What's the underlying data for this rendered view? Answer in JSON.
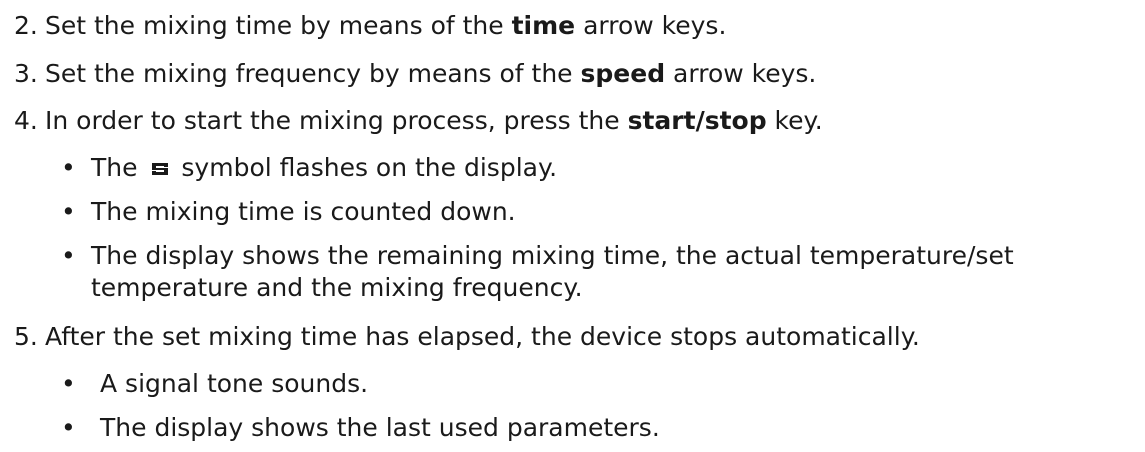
{
  "steps": [
    {
      "num": "2.",
      "pre": "Set the mixing time by means of the ",
      "bold": "time",
      "post": " arrow keys."
    },
    {
      "num": "3.",
      "pre": "Set the mixing frequency by means of the ",
      "bold": "speed",
      "post": " arrow keys."
    },
    {
      "num": "4.",
      "pre": "In order to start the mixing process, press the ",
      "bold": "start/stop",
      "post": " key.",
      "bullets": [
        {
          "pre": "The ",
          "icon": "mixing-symbol-icon",
          "post": " symbol flashes on the display."
        },
        {
          "text": "The mixing time is counted down."
        },
        {
          "line1": "The display shows the remaining mixing time, the actual temperature/set",
          "line2": "temperature and the mixing frequency."
        }
      ]
    },
    {
      "num": "5.",
      "text": "After the set mixing time has elapsed, the device stops automatically.",
      "bullets": [
        {
          "text": "A signal tone sounds."
        },
        {
          "text": "The display shows the last used parameters."
        }
      ]
    }
  ],
  "bullet_char": "•",
  "colors": {
    "text": "#1a1a1a",
    "background": "#ffffff"
  }
}
